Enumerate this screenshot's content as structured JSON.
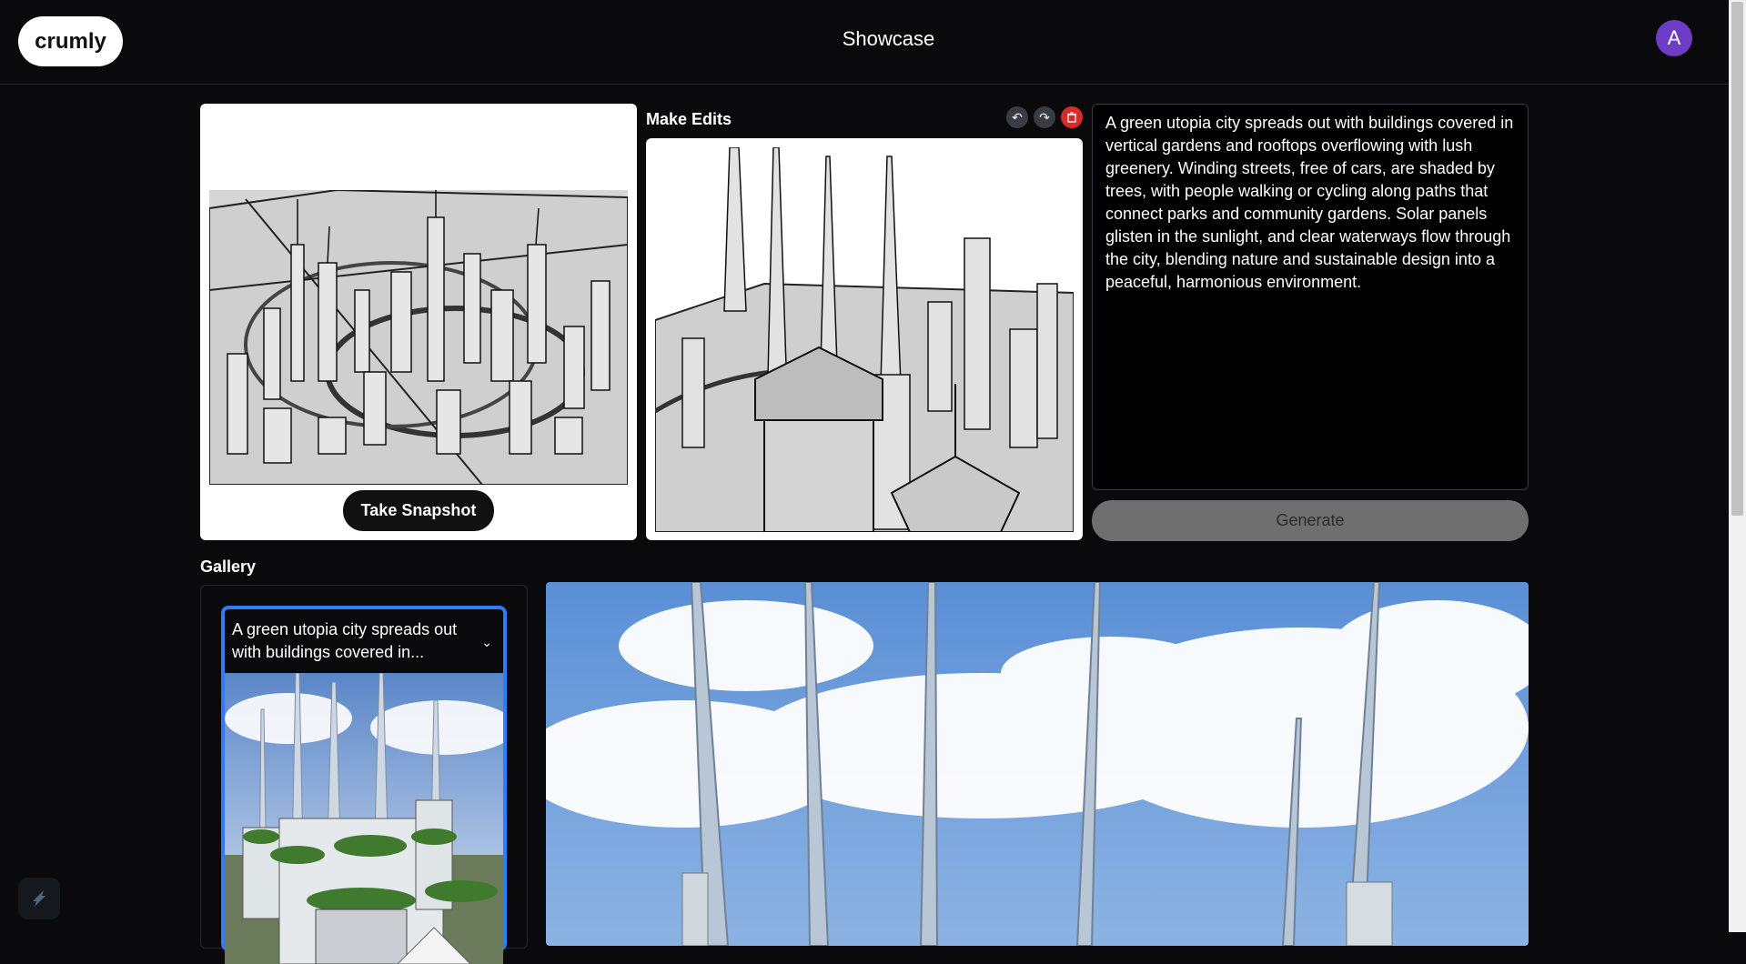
{
  "header": {
    "logo": "crumly",
    "title": "Showcase",
    "avatar_initial": "A"
  },
  "snapshot": {
    "button_label": "Take Snapshot"
  },
  "editor": {
    "title": "Make Edits",
    "tools": [
      "undo-icon",
      "redo-icon",
      "trash-icon"
    ]
  },
  "prompt": {
    "text": "A green utopia city spreads out with buildings covered in vertical gardens and rooftops overflowing with lush greenery. Winding streets, free of cars, are shaded by trees, with people walking or cycling along paths that connect parks and community gardens. Solar panels glisten in the sunlight, and clear waterways flow through the city, blending nature and sustainable design into a peaceful, harmonious environment."
  },
  "generate": {
    "label": "Generate"
  },
  "gallery": {
    "title": "Gallery",
    "items": [
      {
        "caption": "A green utopia city spreads out with buildings covered in...",
        "selected": true
      }
    ]
  },
  "colors": {
    "background": "#0a0a0c",
    "accent_blue": "#2f7cf6",
    "avatar_purple": "#6d3cc4",
    "delete_red": "#d62b2b"
  }
}
